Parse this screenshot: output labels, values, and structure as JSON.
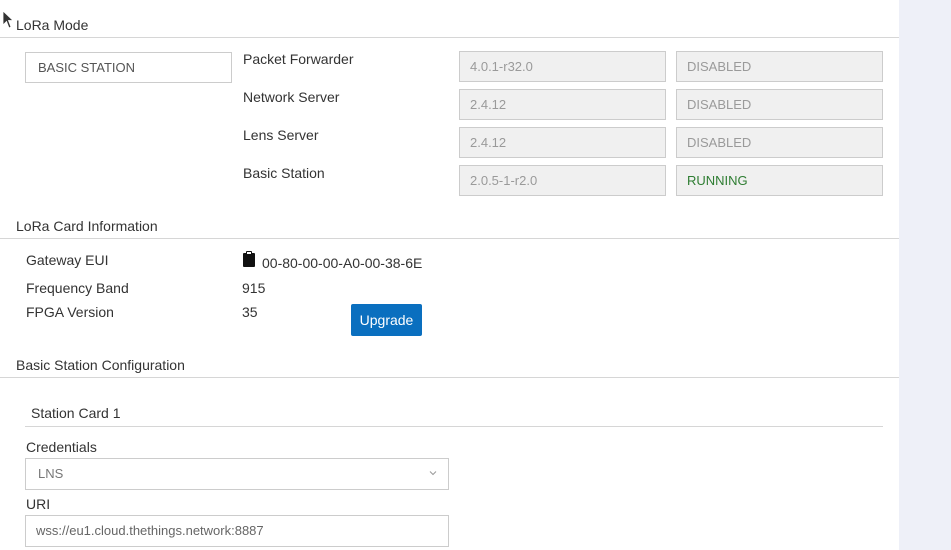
{
  "lora_mode": {
    "title": "LoRa Mode",
    "mode_value": "BASIC STATION",
    "services": [
      {
        "name": "Packet Forwarder",
        "version": "4.0.1-r32.0",
        "status": "DISABLED"
      },
      {
        "name": "Network Server",
        "version": "2.4.12",
        "status": "DISABLED"
      },
      {
        "name": "Lens Server",
        "version": "2.4.12",
        "status": "DISABLED"
      },
      {
        "name": "Basic Station",
        "version": "2.0.5-1-r2.0",
        "status": "RUNNING"
      }
    ]
  },
  "card_info": {
    "title": "LoRa Card Information",
    "gateway_eui_label": "Gateway EUI",
    "gateway_eui_value": "00-80-00-00-A0-00-38-6E",
    "frequency_band_label": "Frequency Band",
    "frequency_band_value": "915",
    "fpga_version_label": "FPGA Version",
    "fpga_version_value": "35",
    "upgrade_label": "Upgrade"
  },
  "basic_station_config": {
    "title": "Basic Station Configuration",
    "card_title": "Station Card 1",
    "credentials_label": "Credentials",
    "credentials_value": "LNS",
    "uri_label": "URI",
    "uri_value": "wss://eu1.cloud.thethings.network:8887"
  },
  "colors": {
    "accent": "#0a6fbf",
    "running": "#2e7d32",
    "side_panel": "#eef0f8"
  },
  "icons": [
    "clipboard-icon",
    "chevron-down-icon",
    "mouse-cursor-icon"
  ]
}
